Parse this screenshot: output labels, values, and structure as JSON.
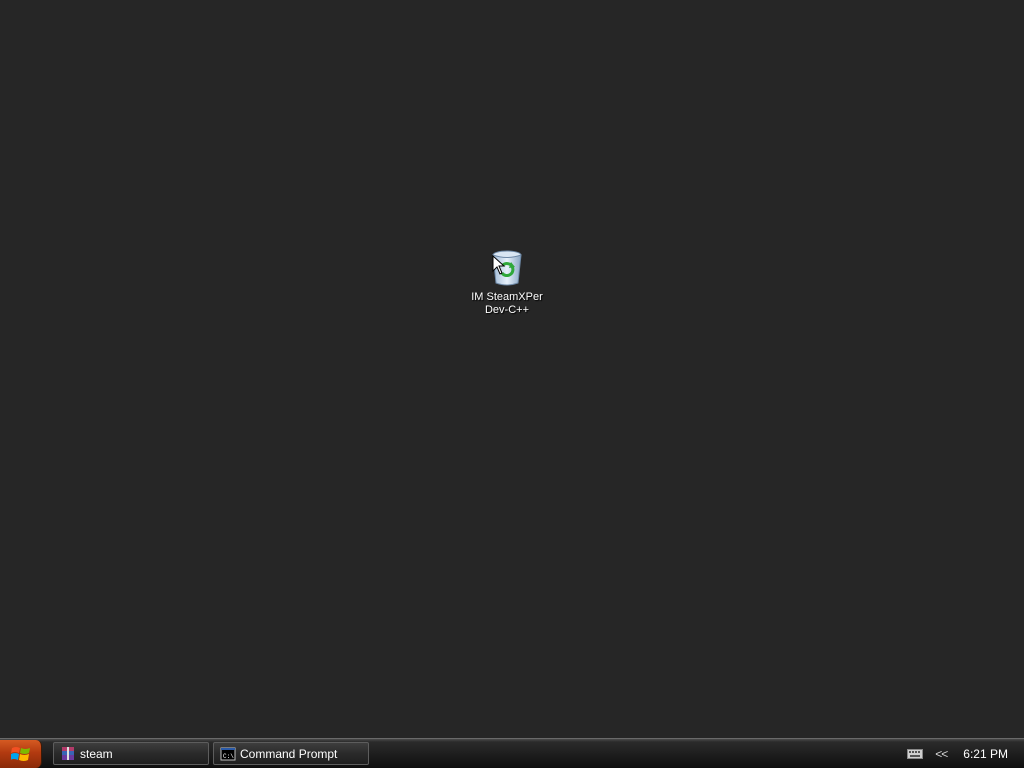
{
  "desktop": {
    "icon": {
      "name": "recycle-bin-icon",
      "label_line1": "IM SteamXPer",
      "label_line2": "Dev-C++"
    }
  },
  "taskbar": {
    "start_icon": "windows-logo-icon",
    "buttons": [
      {
        "label": "steam",
        "icon": "archive-icon"
      },
      {
        "label": "Command Prompt",
        "icon": "command-prompt-icon"
      }
    ],
    "tray": {
      "keyboard_icon": "keyboard-icon",
      "expand_label": "<<",
      "clock": "6:21 PM"
    }
  },
  "colors": {
    "desktop_bg": "#262626",
    "start_orange": "#c04a18"
  }
}
